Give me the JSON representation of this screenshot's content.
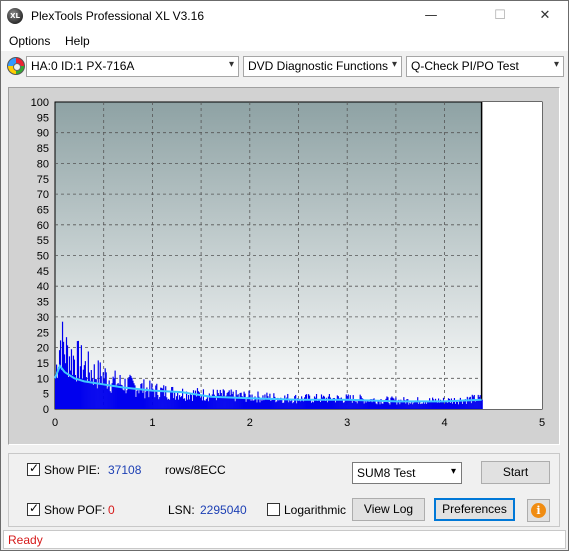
{
  "window": {
    "title": "PlexTools Professional XL V3.16",
    "icon": "xl-logo-icon",
    "minimize_glyph": "—",
    "maximize_glyph": "☐",
    "close_glyph": "✕"
  },
  "menu": {
    "options_label": "Options",
    "help_label": "Help"
  },
  "toolbar": {
    "drive_select": "HA:0 ID:1  PX-716A",
    "function_select": "DVD Diagnostic Functions",
    "test_select": "Q-Check PI/PO Test",
    "dropdown_glyph": "▾"
  },
  "chart_data": {
    "type": "bar",
    "title": "",
    "xlabel": "",
    "ylabel": "",
    "xlim": [
      0,
      5
    ],
    "ylim": [
      0,
      100
    ],
    "x_ticks": [
      "0",
      "1",
      "2",
      "3",
      "4",
      "5"
    ],
    "y_ticks": [
      "0",
      "5",
      "10",
      "15",
      "20",
      "25",
      "30",
      "35",
      "40",
      "45",
      "50",
      "55",
      "60",
      "65",
      "70",
      "75",
      "80",
      "85",
      "90",
      "95",
      "100"
    ],
    "grid": true,
    "data_end_x": 4.38,
    "series": [
      {
        "kind": "bars",
        "color": "#0000ee",
        "x": [
          0.0,
          0.05,
          0.1,
          0.15,
          0.2,
          0.3,
          0.4,
          0.5,
          0.6,
          0.8,
          1.0,
          1.2,
          1.5,
          2.0,
          2.5,
          3.0,
          3.5,
          4.0,
          4.38
        ],
        "values": [
          17,
          33,
          28,
          25,
          24,
          20,
          17,
          16,
          13,
          11,
          9,
          8,
          7,
          6,
          5,
          5,
          4,
          4,
          5
        ]
      },
      {
        "kind": "line",
        "color": "#3fc7ff",
        "x": [
          0.0,
          0.05,
          0.1,
          0.2,
          0.3,
          0.5,
          0.7,
          1.0,
          1.3,
          1.6,
          2.0,
          2.5,
          3.0,
          3.5,
          4.0,
          4.38
        ],
        "values": [
          10,
          14,
          12,
          10,
          9,
          8,
          7,
          6,
          5.5,
          4,
          3.5,
          3,
          3,
          2.5,
          2.5,
          3
        ]
      }
    ]
  },
  "controls": {
    "show_pie_label": "Show PIE:",
    "show_pie_checked": true,
    "pie_value": "37108",
    "rows_label": "rows/8ECC",
    "sum_select": "SUM8 Test",
    "start_button": "Start",
    "show_pof_label": "Show POF:",
    "show_pof_checked": true,
    "pof_value": "0",
    "lsn_label": "LSN:",
    "lsn_value": "2295040",
    "logarithmic_label": "Logarithmic",
    "logarithmic_checked": false,
    "view_log_button": "View Log",
    "preferences_button": "Preferences",
    "info_glyph": "i",
    "checkmark_glyph": "✓"
  },
  "status": {
    "text": "Ready"
  },
  "colors": {
    "bar": "#0000ee",
    "line": "#3fc7ff",
    "status_text": "#d61a1a",
    "value_blue": "#1c3fb4"
  }
}
